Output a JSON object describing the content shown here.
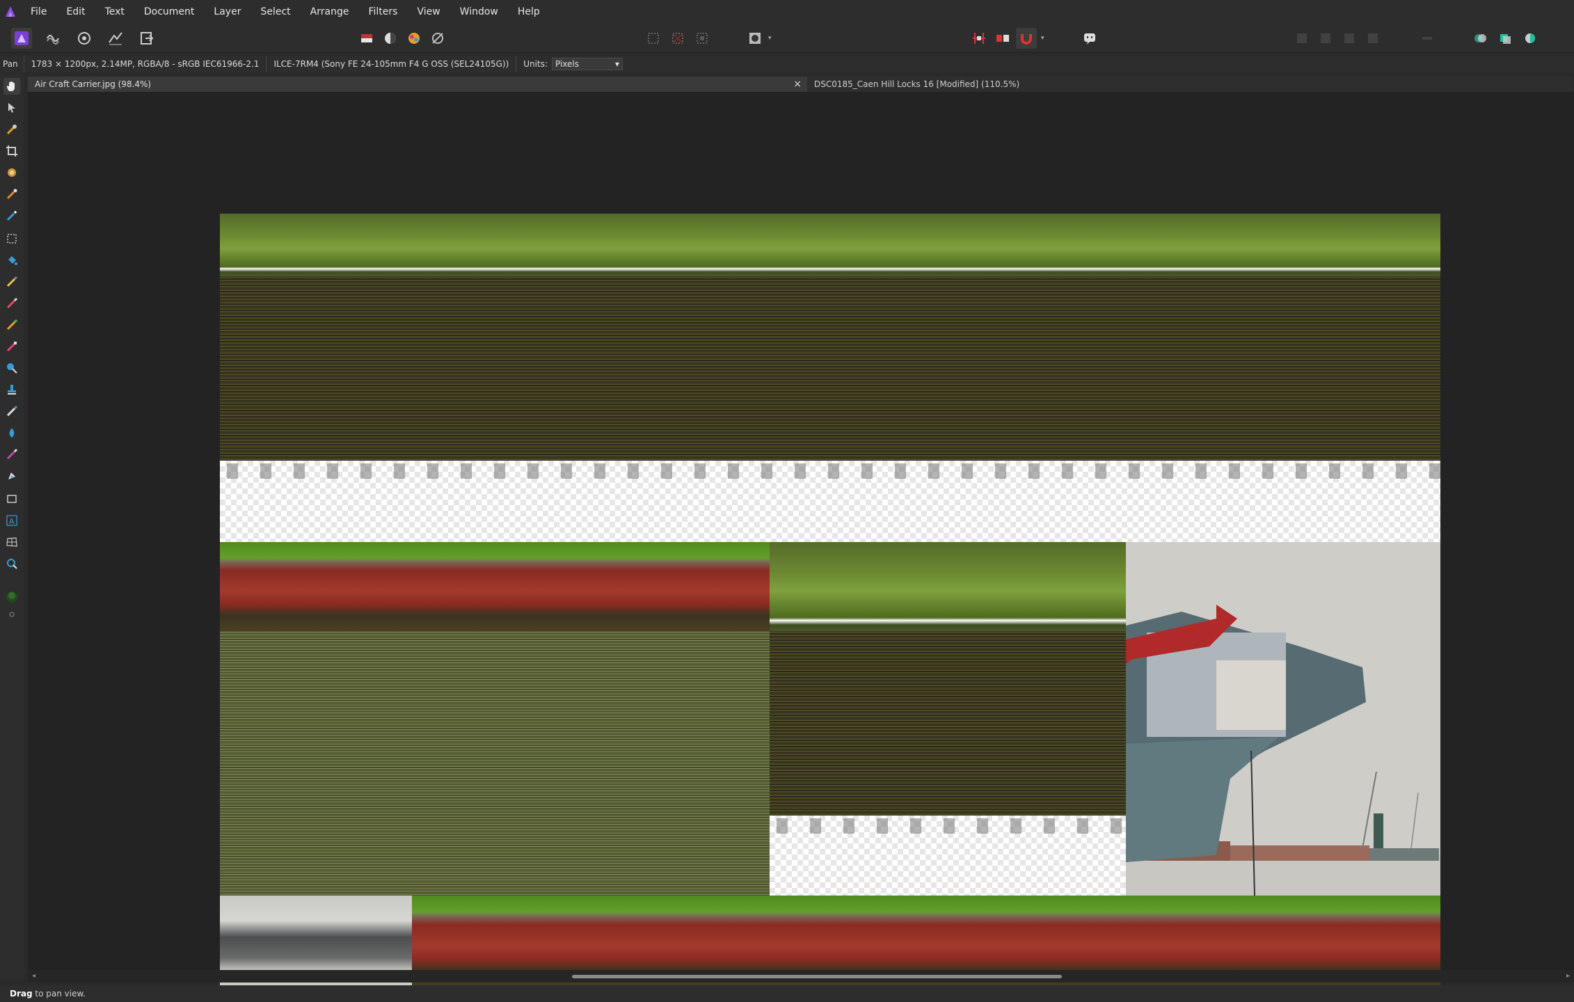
{
  "menu": {
    "items": [
      "File",
      "Edit",
      "Text",
      "Document",
      "Layer",
      "Select",
      "Arrange",
      "Filters",
      "View",
      "Window",
      "Help"
    ]
  },
  "context": {
    "tool": "Pan",
    "image_info": "1783 × 1200px, 2.14MP, RGBA/8 - sRGB IEC61966-2.1",
    "camera_info": "ILCE-7RM4 (Sony FE 24-105mm F4 G OSS (SEL24105G))",
    "units_label": "Units:",
    "units_value": "Pixels"
  },
  "tabs": [
    {
      "label": "Air Craft Carrier.jpg (98.4%)",
      "close": "×"
    },
    {
      "label": "DSC0185_Caen Hill Locks 16 [Modified] (110.5%)"
    }
  ],
  "status": {
    "action": "Drag",
    "hint": " to pan view."
  },
  "colors": {
    "panel": "#2d2d2d",
    "canvas_bg": "#232323",
    "accent": "#7a3fd6"
  }
}
